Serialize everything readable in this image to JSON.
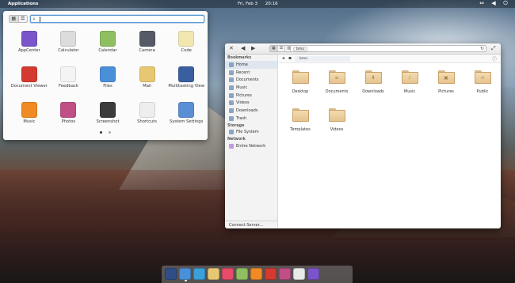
{
  "panel": {
    "applications_label": "Applications",
    "date": "Fri, Feb 3",
    "time": "20:16",
    "tray_icons": [
      "network-icon",
      "sound-icon",
      "power-icon"
    ]
  },
  "launcher": {
    "search_placeholder": "",
    "apps": [
      {
        "label": "AppCenter",
        "icon": "appcenter-icon",
        "color": "#7a55c9"
      },
      {
        "label": "Calculator",
        "icon": "calculator-icon",
        "color": "#dcdcdc"
      },
      {
        "label": "Calendar",
        "icon": "calendar-icon",
        "color": "#8fbf60"
      },
      {
        "label": "Camera",
        "icon": "camera-icon",
        "color": "#555a66"
      },
      {
        "label": "Code",
        "icon": "code-icon",
        "color": "#f3e7b0"
      },
      {
        "label": "Document Viewer",
        "icon": "document-viewer-icon",
        "color": "#d43a2f"
      },
      {
        "label": "Feedback",
        "icon": "feedback-icon",
        "color": "#f4f4f4"
      },
      {
        "label": "Files",
        "icon": "files-icon",
        "color": "#4a90d9"
      },
      {
        "label": "Mail",
        "icon": "mail-icon",
        "color": "#e8c773"
      },
      {
        "label": "Multitasking View",
        "icon": "multitasking-icon",
        "color": "#3a5fa0"
      },
      {
        "label": "Music",
        "icon": "music-icon",
        "color": "#f08a24"
      },
      {
        "label": "Photos",
        "icon": "photos-icon",
        "color": "#c04f86"
      },
      {
        "label": "Screenshot",
        "icon": "screenshot-icon",
        "color": "#3b3b3b"
      },
      {
        "label": "Shortcuts",
        "icon": "shortcuts-icon",
        "color": "#eeeeee"
      },
      {
        "label": "System Settings",
        "icon": "settings-icon",
        "color": "#5a8fd6"
      }
    ],
    "pages": 2,
    "current_page": 1
  },
  "files": {
    "path_label": "bmo",
    "sidebar": {
      "bookmarks_title": "Bookmarks",
      "bookmarks": [
        "Home",
        "Recent",
        "Documents",
        "Music",
        "Pictures",
        "Videos",
        "Downloads",
        "Trash"
      ],
      "selected": "Home",
      "storage_title": "Storage",
      "storage": [
        "File System"
      ],
      "network_title": "Network",
      "network": [
        "Entire Network"
      ],
      "connect_server": "Connect Server..."
    },
    "folders": [
      {
        "label": "Desktop",
        "emblem": ""
      },
      {
        "label": "Documents",
        "emblem": "≡"
      },
      {
        "label": "Downloads",
        "emblem": "⬇"
      },
      {
        "label": "Music",
        "emblem": "♪"
      },
      {
        "label": "Pictures",
        "emblem": "▣"
      },
      {
        "label": "Public",
        "emblem": "⋖"
      },
      {
        "label": "Templates",
        "emblem": ""
      },
      {
        "label": "Videos",
        "emblem": ""
      }
    ]
  },
  "dock": [
    {
      "icon": "multitasking-icon",
      "color": "#2f4e86",
      "running": false
    },
    {
      "icon": "files-icon",
      "color": "#4a90d9",
      "running": true
    },
    {
      "icon": "web-browser-icon",
      "color": "#3aa0d8",
      "running": false
    },
    {
      "icon": "mail-icon",
      "color": "#e8c773",
      "running": false
    },
    {
      "icon": "tasks-icon",
      "color": "#e94b6a",
      "running": false
    },
    {
      "icon": "calendar-icon",
      "color": "#8fbf60",
      "running": false
    },
    {
      "icon": "music-icon",
      "color": "#f08a24",
      "running": false
    },
    {
      "icon": "videos-icon",
      "color": "#d43a2f",
      "running": false
    },
    {
      "icon": "photos-icon",
      "color": "#c04f86",
      "running": false
    },
    {
      "icon": "terminal-icon",
      "color": "#e9e9e9",
      "running": false
    },
    {
      "icon": "appcenter-icon",
      "color": "#7a55c9",
      "running": false
    }
  ]
}
